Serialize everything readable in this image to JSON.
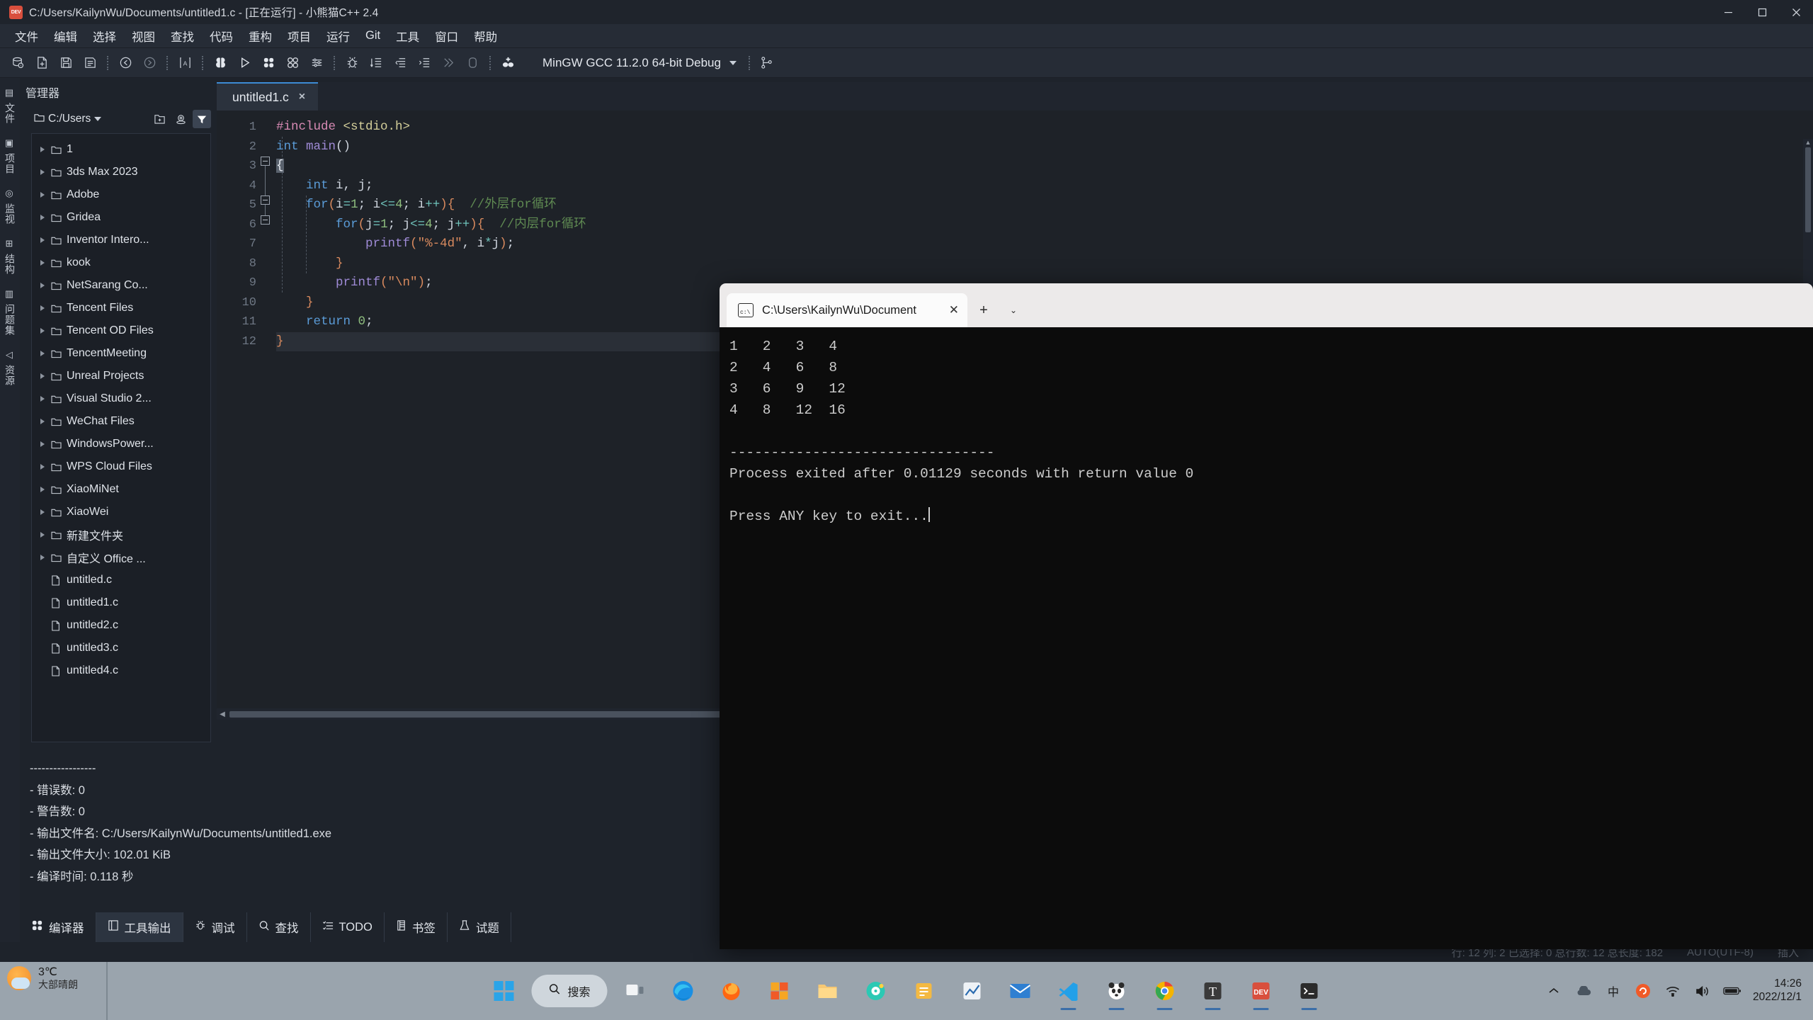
{
  "titlebar": {
    "icon": "panda-dev-icon",
    "title": "C:/Users/KailynWu/Documents/untitled1.c - [正在运行] - 小熊猫C++ 2.4",
    "minimize": "minimize-button",
    "maximize": "maximize-button",
    "close": "close-button"
  },
  "menubar": {
    "items": [
      {
        "label": "文件",
        "name": "menu-file"
      },
      {
        "label": "编辑",
        "name": "menu-edit"
      },
      {
        "label": "选择",
        "name": "menu-select"
      },
      {
        "label": "视图",
        "name": "menu-view"
      },
      {
        "label": "查找",
        "name": "menu-find"
      },
      {
        "label": "代码",
        "name": "menu-code"
      },
      {
        "label": "重构",
        "name": "menu-refactor"
      },
      {
        "label": "项目",
        "name": "menu-project"
      },
      {
        "label": "运行",
        "name": "menu-run"
      },
      {
        "label": "Git",
        "name": "menu-git"
      },
      {
        "label": "工具",
        "name": "menu-tools"
      },
      {
        "label": "窗口",
        "name": "menu-window"
      },
      {
        "label": "帮助",
        "name": "menu-help"
      }
    ]
  },
  "toolbar": {
    "compiler_set": "MinGW GCC 11.2.0 64-bit Debug",
    "icons": [
      "open-project-icon",
      "new-file-icon",
      "save-icon",
      "save-all-icon",
      "undo-icon",
      "redo-icon",
      "select-all-icon",
      "compile-icon",
      "run-icon",
      "compile-run-icon",
      "rebuild-icon",
      "options-icon",
      "debug-icon",
      "indent-icon",
      "unindent-icon",
      "toggle-comment-icon",
      "step-over-icon",
      "stop-icon",
      "add-watch-icon"
    ]
  },
  "rail": {
    "tabs": [
      {
        "label": "文件",
        "icon": "files-icon",
        "active": false,
        "name": "rail-tab-files"
      },
      {
        "label": "项目",
        "icon": "project-icon",
        "active": false,
        "name": "rail-tab-project"
      },
      {
        "label": "监视",
        "icon": "watch-icon",
        "active": false,
        "name": "rail-tab-watch"
      },
      {
        "label": "结构",
        "icon": "structure-icon",
        "active": false,
        "name": "rail-tab-structure"
      },
      {
        "label": "问题集",
        "icon": "problemset-icon",
        "active": false,
        "name": "rail-tab-problemset"
      },
      {
        "label": "资源",
        "icon": "resource-icon",
        "active": false,
        "name": "rail-tab-resource"
      }
    ]
  },
  "manager": {
    "header": "管理器",
    "path": "C:/Users",
    "buttons": [
      "new-folder-icon",
      "locate-icon",
      "filter-icon"
    ],
    "tree": [
      {
        "label": "1",
        "type": "folder"
      },
      {
        "label": "3ds Max 2023",
        "type": "folder"
      },
      {
        "label": "Adobe",
        "type": "folder"
      },
      {
        "label": "Gridea",
        "type": "folder"
      },
      {
        "label": "Inventor Intero...",
        "type": "folder"
      },
      {
        "label": "kook",
        "type": "folder"
      },
      {
        "label": "NetSarang Co...",
        "type": "folder"
      },
      {
        "label": "Tencent Files",
        "type": "folder"
      },
      {
        "label": "Tencent OD Files",
        "type": "folder"
      },
      {
        "label": "TencentMeeting",
        "type": "folder"
      },
      {
        "label": "Unreal Projects",
        "type": "folder"
      },
      {
        "label": "Visual Studio 2...",
        "type": "folder"
      },
      {
        "label": "WeChat Files",
        "type": "folder"
      },
      {
        "label": "WindowsPower...",
        "type": "folder"
      },
      {
        "label": "WPS Cloud Files",
        "type": "folder"
      },
      {
        "label": "XiaoMiNet",
        "type": "folder"
      },
      {
        "label": "XiaoWei",
        "type": "folder"
      },
      {
        "label": "新建文件夹",
        "type": "folder"
      },
      {
        "label": "自定义 Office ...",
        "type": "folder"
      },
      {
        "label": "untitled.c",
        "type": "file"
      },
      {
        "label": "untitled1.c",
        "type": "file"
      },
      {
        "label": "untitled2.c",
        "type": "file"
      },
      {
        "label": "untitled3.c",
        "type": "file"
      },
      {
        "label": "untitled4.c",
        "type": "file"
      }
    ]
  },
  "editor": {
    "tab": {
      "label": "untitled1.c",
      "close": "×"
    },
    "lines": [
      {
        "n": "1",
        "html": "<span class=\"pp\">#include</span> <span class=\"hdr\">&lt;stdio.h&gt;</span>"
      },
      {
        "n": "2",
        "html": "<span class=\"k\">int</span> <span class=\"kw2\">main</span><span class=\"pn\">()</span>"
      },
      {
        "n": "3",
        "html": "<span class=\"curbrace\">{</span>"
      },
      {
        "n": "4",
        "html": "    <span class=\"k\">int</span> <span class=\"pn\">i, j;</span>"
      },
      {
        "n": "5",
        "html": "    <span class=\"k\">for</span><span class=\"br\">(</span><span class=\"pn\">i</span><span class=\"op\">=</span><span class=\"num\">1</span><span class=\"pn\">; </span><span class=\"pn\">i</span><span class=\"op\">&lt;=</span><span class=\"num\">4</span><span class=\"pn\">; </span><span class=\"pn\">i</span><span class=\"op\">++</span><span class=\"br\">){</span>  <span class=\"cm\">//外层for循环</span>"
      },
      {
        "n": "6",
        "html": "        <span class=\"k\">for</span><span class=\"br\">(</span><span class=\"pn\">j</span><span class=\"op\">=</span><span class=\"num\">1</span><span class=\"pn\">; </span><span class=\"pn\">j</span><span class=\"op\">&lt;=</span><span class=\"num\">4</span><span class=\"pn\">; </span><span class=\"pn\">j</span><span class=\"op\">++</span><span class=\"br\">){</span>  <span class=\"cm\">//内层for循环</span>"
      },
      {
        "n": "7",
        "html": "            <span class=\"kw2\">printf</span><span class=\"br\">(</span><span class=\"st\">\"%-4d\"</span><span class=\"pn\">, i</span><span class=\"op\">*</span><span class=\"pn\">j</span><span class=\"br\">)</span><span class=\"pn\">;</span>"
      },
      {
        "n": "8",
        "html": "        <span class=\"br\">}</span>"
      },
      {
        "n": "9",
        "html": "        <span class=\"kw2\">printf</span><span class=\"br\">(</span><span class=\"st\">\"\\n\"</span><span class=\"br\">)</span><span class=\"pn\">;</span>"
      },
      {
        "n": "10",
        "html": "    <span class=\"br\">}</span>"
      },
      {
        "n": "11",
        "html": "    <span class=\"k\">return</span> <span class=\"num\">0</span><span class=\"pn\">;</span>"
      },
      {
        "n": "12",
        "html": "<span class=\"br\">}</span>"
      }
    ],
    "current_line": 12
  },
  "output": {
    "lines": [
      "-----------------",
      "- 错误数: 0",
      "- 警告数: 0",
      "- 输出文件名: C:/Users/KailynWu/Documents/untitled1.exe",
      "- 输出文件大小: 102.01 KiB",
      "- 编译时间: 0.118 秒"
    ]
  },
  "bottom_tabs": [
    {
      "label": "编译器",
      "icon": "compiler-icon",
      "active": false,
      "name": "bottom-tab-compiler"
    },
    {
      "label": "工具输出",
      "icon": "tool-output-icon",
      "active": true,
      "name": "bottom-tab-tool-output"
    },
    {
      "label": "调试",
      "icon": "debug-icon",
      "active": false,
      "name": "bottom-tab-debug"
    },
    {
      "label": "查找",
      "icon": "search-icon",
      "active": false,
      "name": "bottom-tab-find"
    },
    {
      "label": "TODO",
      "icon": "todo-icon",
      "active": false,
      "name": "bottom-tab-todo"
    },
    {
      "label": "书签",
      "icon": "bookmark-icon",
      "active": false,
      "name": "bottom-tab-bookmark"
    },
    {
      "label": "试题",
      "icon": "problem-icon",
      "active": false,
      "name": "bottom-tab-problem"
    }
  ],
  "statusbar": {
    "position": "行: 12 列: 2 已选择: 0 总行数: 12 总长度: 182",
    "encoding": "AUTO(UTF-8)",
    "insert_mode": "插入"
  },
  "terminal": {
    "tab_title": "C:\\Users\\KailynWu\\Document",
    "tab_icon": "console-icon",
    "new_tab": "+",
    "chevron": "⌄",
    "body": "1   2   3   4   \n2   4   6   8   \n3   6   9   12  \n4   8   12  16  \n\n--------------------------------\nProcess exited after 0.01129 seconds with return value 0\n\nPress ANY key to exit...",
    "output_rows": [
      [
        "1",
        "2",
        "3",
        "4"
      ],
      [
        "2",
        "4",
        "6",
        "8"
      ],
      [
        "3",
        "6",
        "9",
        "12"
      ],
      [
        "4",
        "8",
        "12",
        "16"
      ]
    ],
    "separator": "--------------------------------",
    "exit_message": "Process exited after 0.01129 seconds with return value 0",
    "prompt": "Press ANY key to exit..."
  },
  "taskbar": {
    "weather_temp": "3℃",
    "weather_desc": "大部晴朗",
    "search_label": "搜索",
    "start": "start-button",
    "apps": [
      {
        "name": "taskview-icon"
      },
      {
        "name": "edge-icon"
      },
      {
        "name": "firefox-icon"
      },
      {
        "name": "store-icon"
      },
      {
        "name": "explorer-icon"
      },
      {
        "name": "qq-music-icon"
      },
      {
        "name": "notes-icon"
      },
      {
        "name": "chart-icon"
      },
      {
        "name": "mail-icon"
      },
      {
        "name": "vscode-icon",
        "active": true
      },
      {
        "name": "panda-cpp-icon",
        "active": true
      },
      {
        "name": "chrome-icon",
        "active": true
      },
      {
        "name": "typora-icon",
        "active": true
      },
      {
        "name": "devcpp-icon",
        "active": true
      },
      {
        "name": "terminal-icon",
        "active": true
      }
    ],
    "tray": [
      "chevron-up-icon",
      "cloud-icon",
      "ime-icon",
      "sogou-icon",
      "wifi-icon",
      "volume-icon",
      "battery-icon"
    ],
    "ime": "中",
    "clock_time": "14:26",
    "clock_date": "2022/12/1"
  },
  "colors": {
    "accent": "#3d8bd4",
    "panel_bg": "#262c36",
    "editor_bg": "#1e2228",
    "terminal_bg": "#0c0c0c",
    "taskbar_bg": "#9aa4ad"
  }
}
